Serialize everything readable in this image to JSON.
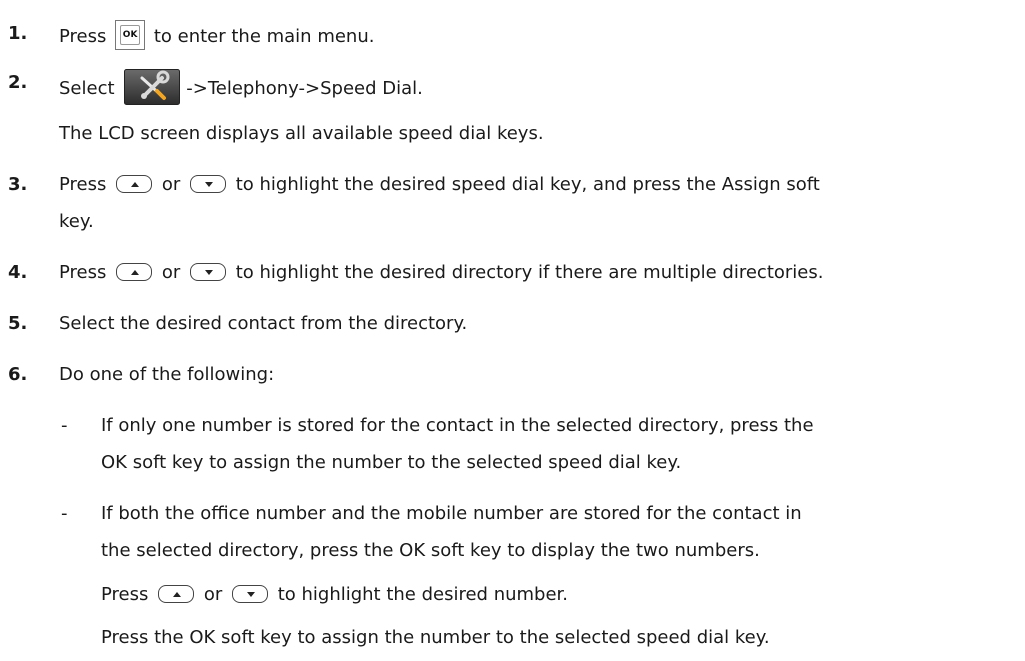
{
  "steps": [
    {
      "n": "1.",
      "before": "Press ",
      "icon": "ok-key-icon",
      "after": " to enter the main menu."
    },
    {
      "n": "2.",
      "before": "Select ",
      "icon": "settings-tools-icon",
      "after": "->Telephony->Speed Dial."
    },
    {
      "text": "The LCD screen displays all available speed dial keys."
    },
    {
      "n": "3.",
      "p1": "Press ",
      "or": " or ",
      "p2": " to highlight the desired speed dial key, and press the Assign soft"
    },
    {
      "text": "key."
    },
    {
      "n": "4.",
      "p1": "Press ",
      "or": " or ",
      "p2": " to highlight the desired directory if there are multiple directories."
    },
    {
      "n": "5.",
      "text": "Select the desired contact from the directory."
    },
    {
      "n": "6.",
      "text": "Do one of the following:"
    }
  ],
  "bullets": [
    {
      "dash": "-",
      "lines": [
        "If only one number is stored for the contact in the selected directory, press the",
        "OK soft key to assign the number to the selected speed dial key."
      ]
    },
    {
      "dash": "-",
      "lines": [
        "If both the office number and the mobile number are stored for the contact in",
        "the selected directory, press the OK soft key to display the two numbers."
      ]
    }
  ],
  "sub": {
    "press_p1": "Press ",
    "press_or": " or ",
    "press_p2": " to highlight the desired number.",
    "final": "Press the OK soft key to assign the number to the selected speed dial key."
  },
  "icons": {
    "ok_label": "OK",
    "up_arrow": "up-arrow-key-icon",
    "down_arrow": "down-arrow-key-icon"
  }
}
